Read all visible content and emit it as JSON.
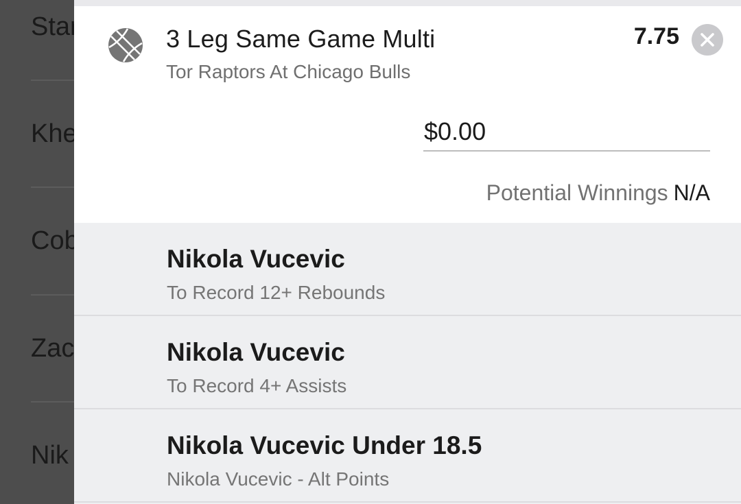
{
  "background_list": {
    "rows": [
      "Star",
      "Khe",
      "Cob",
      "Zac",
      "Nik"
    ]
  },
  "bet": {
    "title": "3 Leg Same Game Multi",
    "subtitle": "Tor Raptors At Chicago Bulls",
    "odds": "7.75",
    "stake_value": "$0.00",
    "potential_winnings_label": "Potential Winnings",
    "potential_winnings_value": "N/A",
    "sport_icon": "basketball-icon",
    "close_icon": "close-icon"
  },
  "legs": [
    {
      "title": "Nikola Vucevic",
      "subtitle": "To Record 12+ Rebounds"
    },
    {
      "title": "Nikola Vucevic",
      "subtitle": "To Record 4+ Assists"
    },
    {
      "title": "Nikola Vucevic Under 18.5",
      "subtitle": "Nikola Vucevic - Alt Points"
    }
  ],
  "colors": {
    "overlay": "#4d4d4d",
    "card": "#ffffff",
    "leg_background": "#eeeff1",
    "close_button": "#c9c9cc"
  }
}
